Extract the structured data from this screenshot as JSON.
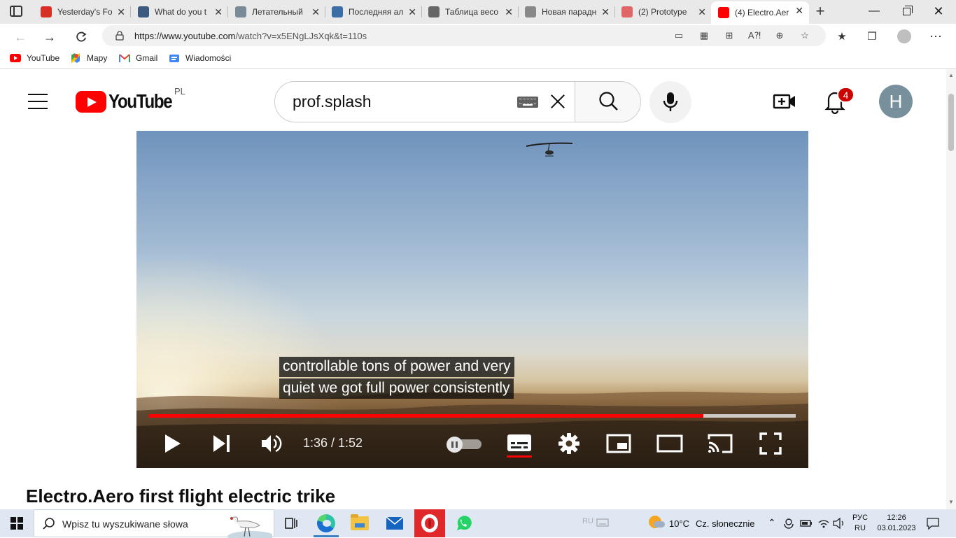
{
  "browser": {
    "tabs": [
      {
        "title": "Yesterday's Fo",
        "favicon": "gmail-icon",
        "color": "#d93025"
      },
      {
        "title": "What do you t",
        "favicon": "h-icon",
        "color": "#3d5a80"
      },
      {
        "title": "Летательный",
        "favicon": "doc-icon",
        "color": "#7a8a99"
      },
      {
        "title": "Последняя ал",
        "favicon": "plane-icon",
        "color": "#3b6ea5"
      },
      {
        "title": "Таблица весо",
        "favicon": "toyota-icon",
        "color": "#666666"
      },
      {
        "title": "Новая парадн",
        "favicon": "s-icon",
        "color": "#888888"
      },
      {
        "title": "(2) Prototype",
        "favicon": "youtube-icon",
        "color": "#e06666"
      },
      {
        "title": "(4) Electro.Aer",
        "favicon": "youtube-icon",
        "color": "#ff0000",
        "active": true
      }
    ],
    "url_host": "https://www.youtube.com",
    "url_path": "/watch?v=x5ENgLJsXqk&t=110s",
    "bookmarks": [
      {
        "label": "YouTube",
        "icon": "youtube-icon"
      },
      {
        "label": "Mapy",
        "icon": "maps-icon"
      },
      {
        "label": "Gmail",
        "icon": "gmail-icon"
      },
      {
        "label": "Wiadomości",
        "icon": "news-icon"
      }
    ]
  },
  "youtube": {
    "logo_text": "YouTube",
    "region": "PL",
    "search_value": "prof.splash",
    "notifications_count": "4",
    "avatar_letter": "H"
  },
  "player": {
    "caption_lines": [
      "controllable tons of power and very",
      "quiet we got full power consistently"
    ],
    "time_display": "1:36 / 1:52",
    "played_fraction": 0.857,
    "buffered_fraction": 1.0,
    "captions_on": true,
    "autoplay_on": false
  },
  "video_title": "Electro.Aero first flight electric trike",
  "taskbar": {
    "search_placeholder": "Wpisz tu wyszukiwane słowa",
    "weather_temp": "10°C",
    "weather_desc": "Cz. słonecznie",
    "lang_top": "РУС",
    "lang_bottom": "RU",
    "time": "12:26",
    "date": "03.01.2023",
    "ime_hint": "RU"
  }
}
